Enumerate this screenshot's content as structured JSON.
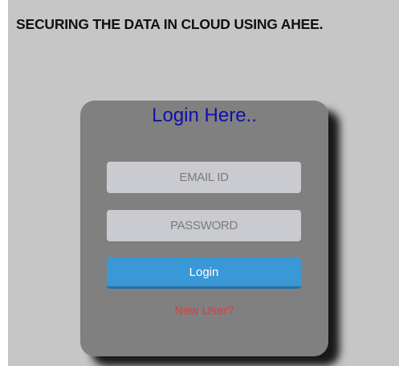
{
  "header": {
    "title": "SECURING THE DATA IN CLOUD USING AHEE."
  },
  "login_form": {
    "heading": "Login Here..",
    "email_placeholder": "EMAIL ID",
    "email_value": "",
    "password_placeholder": "PASSWORD",
    "password_value": "",
    "login_button_label": "Login",
    "new_user_link": "New User?"
  },
  "colors": {
    "page_background": "#c6c6c6",
    "card_background": "#808080",
    "heading_text": "#1010aa",
    "input_background": "#c9cbd0",
    "button_background": "#3a98d6",
    "link_text": "#e03c3c"
  }
}
